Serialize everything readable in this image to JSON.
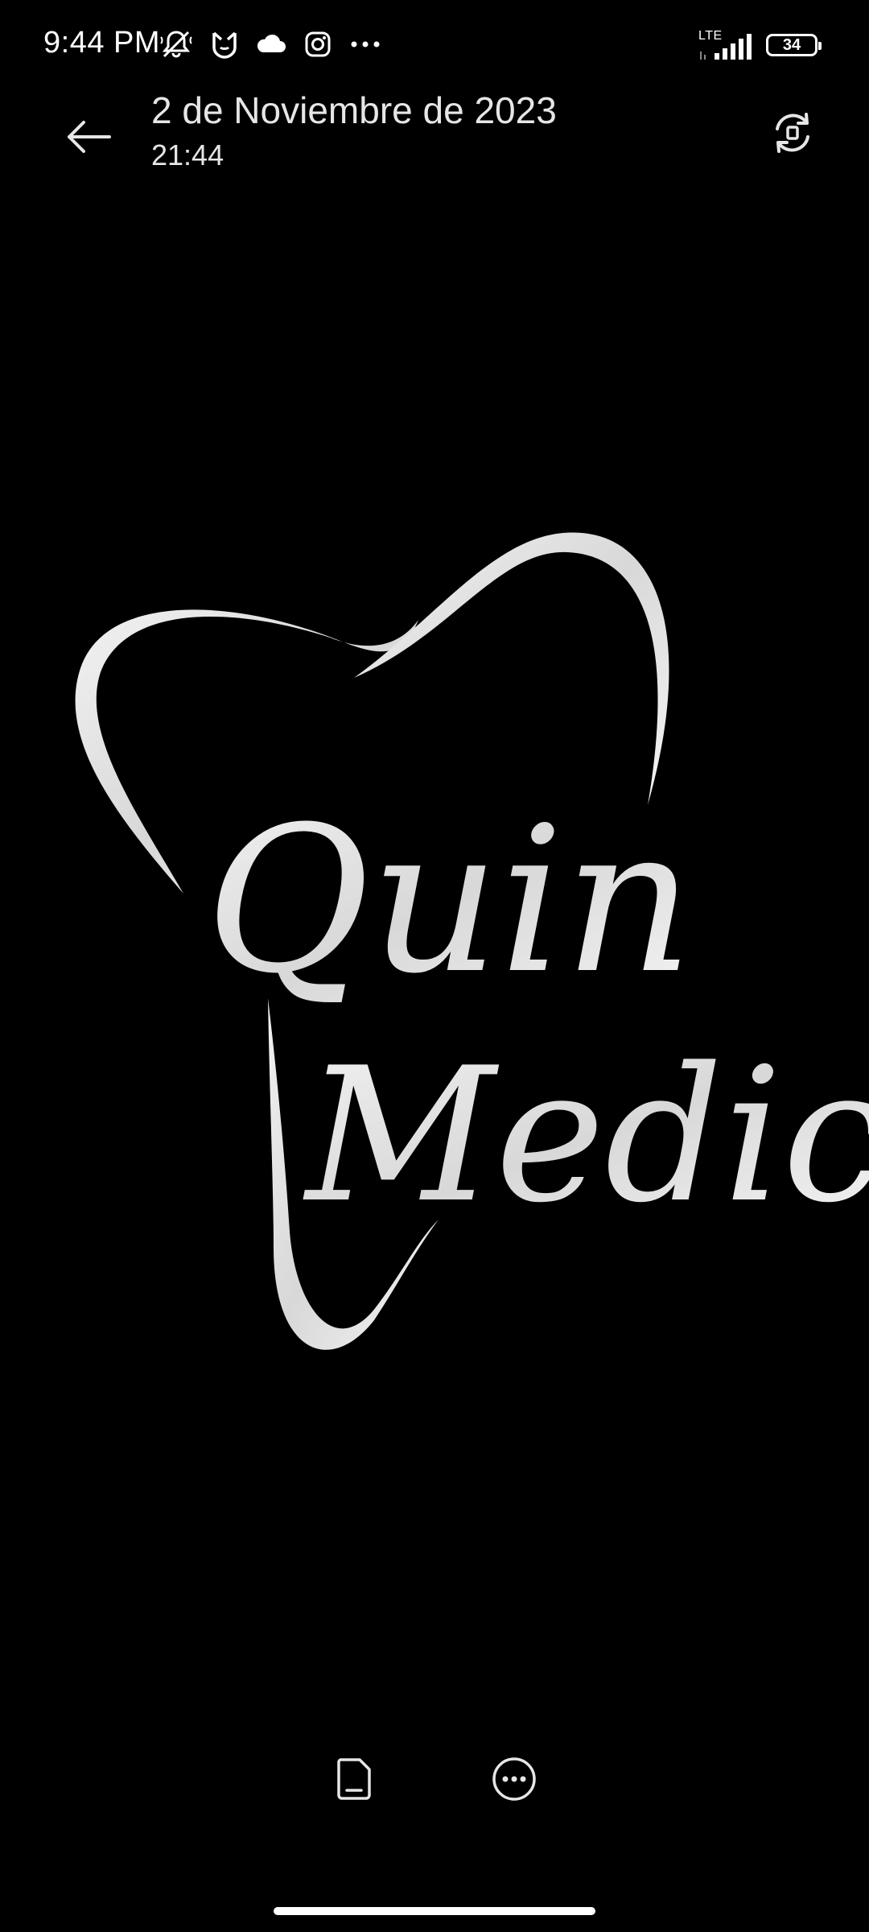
{
  "status_bar": {
    "time": "9:44 PM",
    "left_icons": [
      "muted-bell-icon",
      "mi-app-icon",
      "cloud-icon",
      "instagram-icon",
      "more-dots-icon"
    ],
    "network_label": "LTE",
    "battery_level": "34"
  },
  "header": {
    "title": "2 de Noviembre de 2023",
    "subtitle": "21:44",
    "back_icon": "arrow-left-icon",
    "rotate_icon": "rotate-icon"
  },
  "photo": {
    "logo_text_line1": "Quin",
    "logo_text_line2": "Medic"
  },
  "toolbar": {
    "items": [
      {
        "icon": "document-icon"
      },
      {
        "icon": "more-circle-icon"
      }
    ]
  },
  "colors": {
    "background": "#000000",
    "foreground": "#ffffff",
    "logo": "#e8e8e8"
  }
}
